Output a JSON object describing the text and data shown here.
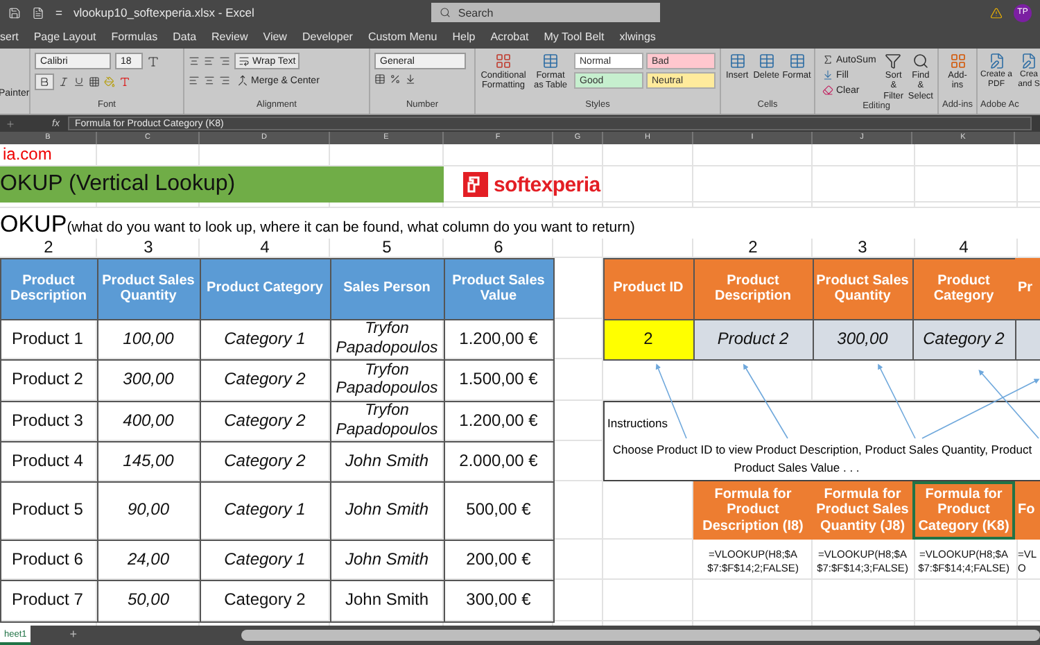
{
  "window": {
    "quick_access": "=",
    "title": "vlookup10_softexperia.xlsx  -  Excel",
    "search_placeholder": "Search",
    "avatar": "TP"
  },
  "ribbon_tabs": [
    "sert",
    "Page Layout",
    "Formulas",
    "Data",
    "Review",
    "View",
    "Developer",
    "Custom Menu",
    "Help",
    "Acrobat",
    "My Tool Belt",
    "xlwings"
  ],
  "ribbon": {
    "clipboard": {
      "painter": "Painter"
    },
    "font": {
      "label": "Font",
      "font_name": "Calibri",
      "font_size": "18",
      "bold": true
    },
    "alignment": {
      "label": "Alignment",
      "wrap": "Wrap Text",
      "merge": "Merge & Center"
    },
    "number": {
      "label": "Number",
      "format": "General"
    },
    "styles": {
      "label": "Styles",
      "conditional": "Conditional Formatting",
      "format_table": "Format as Table",
      "cells": [
        {
          "name": "Normal",
          "color": "#ffffff"
        },
        {
          "name": "Bad",
          "color": "#ffc7ce"
        },
        {
          "name": "Good",
          "color": "#c6efce"
        },
        {
          "name": "Neutral",
          "color": "#ffeb9c"
        }
      ]
    },
    "cells": {
      "label": "Cells",
      "buttons": [
        "Insert",
        "Delete",
        "Format"
      ]
    },
    "editing": {
      "label": "Editing",
      "autosum": "AutoSum",
      "fill": "Fill",
      "clear": "Clear",
      "sort": "Sort & Filter",
      "find": "Find & Select"
    },
    "addins": {
      "label": "Add-ins",
      "button": "Add-ins"
    },
    "adobe": {
      "label": "Adobe Ac",
      "buttons": [
        "Create a PDF",
        "Crea and S"
      ]
    }
  },
  "formula_bar": {
    "fx": "fx",
    "content": "Formula for Product Category (K8)"
  },
  "columns": [
    "B",
    "C",
    "D",
    "E",
    "F",
    "G",
    "H",
    "I",
    "J",
    "K"
  ],
  "sheet": {
    "site_text": "ia.com",
    "banner": "OKUP (Vertical Lookup)",
    "logo": "softexperia",
    "subtitle_big": "OKUP",
    "subtitle_small": "(what do you want to look up, where it can be found, what column do you want to return)",
    "left_table": {
      "col_numbers": [
        "2",
        "3",
        "4",
        "5",
        "6"
      ],
      "headers": [
        "Product Description",
        "Product Sales Quantity",
        "Product Category",
        "Sales Person",
        "Product Sales Value"
      ],
      "rows": [
        [
          {
            "text": "Product 1",
            "italic": false
          },
          {
            "text": "100,00",
            "italic": true
          },
          {
            "text": "Category 1",
            "italic": true
          },
          {
            "text": "Tryfon Papadopoulos",
            "italic": true
          },
          {
            "text": "1.200,00 €",
            "italic": false
          }
        ],
        [
          {
            "text": "Product 2",
            "italic": false
          },
          {
            "text": "300,00",
            "italic": true
          },
          {
            "text": "Category 2",
            "italic": true
          },
          {
            "text": "Tryfon Papadopoulos",
            "italic": true
          },
          {
            "text": "1.500,00 €",
            "italic": false
          }
        ],
        [
          {
            "text": "Product 3",
            "italic": false
          },
          {
            "text": "400,00",
            "italic": true
          },
          {
            "text": "Category 2",
            "italic": true
          },
          {
            "text": "Tryfon Papadopoulos",
            "italic": true
          },
          {
            "text": "1.200,00 €",
            "italic": false
          }
        ],
        [
          {
            "text": "Product 4",
            "italic": false
          },
          {
            "text": "145,00",
            "italic": true
          },
          {
            "text": "Category 2",
            "italic": true
          },
          {
            "text": "John Smith",
            "italic": true
          },
          {
            "text": "2.000,00 €",
            "italic": false
          }
        ],
        [
          {
            "text": "Product 5",
            "italic": false
          },
          {
            "text": "90,00",
            "italic": true
          },
          {
            "text": "Category 1",
            "italic": true
          },
          {
            "text": "John Smith",
            "italic": true
          },
          {
            "text": "500,00 €",
            "italic": false
          }
        ],
        [
          {
            "text": "Product 6",
            "italic": false
          },
          {
            "text": "24,00",
            "italic": true
          },
          {
            "text": "Category 1",
            "italic": true
          },
          {
            "text": "John Smith",
            "italic": true
          },
          {
            "text": "200,00 €",
            "italic": false
          }
        ],
        [
          {
            "text": "Product 7",
            "italic": false
          },
          {
            "text": "50,00",
            "italic": true
          },
          {
            "text": "Category 2",
            "italic": false
          },
          {
            "text": "John Smith",
            "italic": false
          },
          {
            "text": "300,00 €",
            "italic": false
          }
        ]
      ]
    },
    "lookup": {
      "col_numbers": [
        "2",
        "3",
        "4"
      ],
      "headers": [
        "Product ID",
        "Product Description",
        "Product Sales Quantity",
        "Product Category",
        "Pr"
      ],
      "values": [
        "2",
        "Product 2",
        "300,00",
        "Category 2"
      ],
      "instructions_label": "Instructions",
      "instructions_line1": "Choose Product ID to view Product Description, Product Sales Quantity, Product",
      "instructions_line2": "Product Sales Value . . .",
      "formula_headers": [
        {
          "text": "Formula for Product Description (I8)",
          "selected": false
        },
        {
          "text": "Formula for Product Sales Quantity (J8)",
          "selected": false
        },
        {
          "text": "Formula for Product Category (K8)",
          "selected": true
        },
        {
          "text": "Fo",
          "selected": false
        }
      ],
      "formulas": [
        "=VLOOKUP(H8;$A$7:$F$14;2;FALSE)",
        "=VLOOKUP(H8;$A$7:$F$14;3;FALSE)",
        "=VLOOKUP(H8;$A$7:$F$14;4;FALSE)",
        "=VLO"
      ]
    }
  },
  "sheet_tabs": [
    {
      "name": "heet1",
      "selected": true
    }
  ],
  "add_sheet": "+"
}
